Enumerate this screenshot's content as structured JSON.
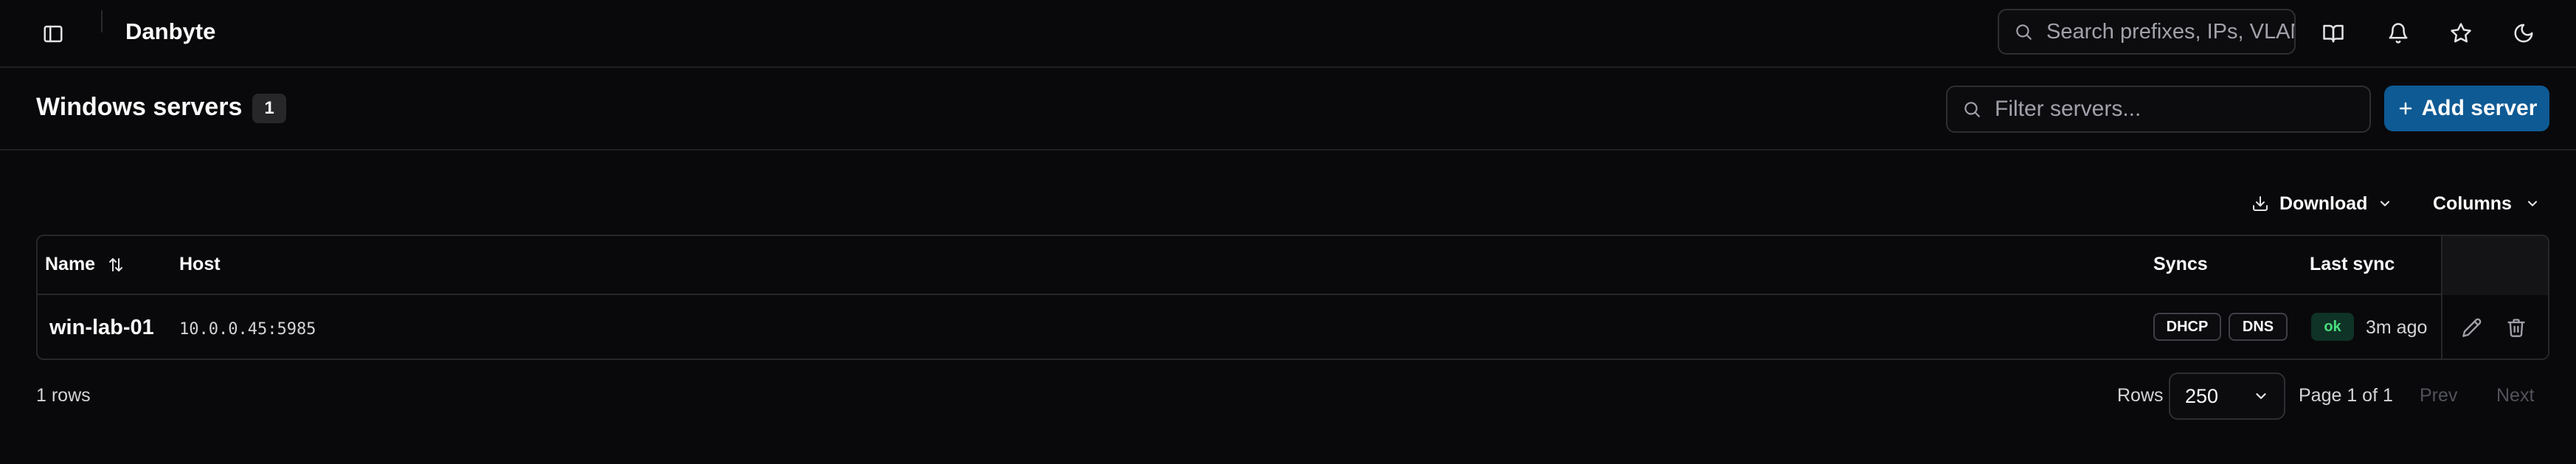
{
  "topbar": {
    "app_title": "Danbyte",
    "search_placeholder": "Search prefixes, IPs, VLANs…",
    "icons": [
      "sidebar-toggle-icon",
      "book-icon",
      "bell-icon",
      "star-icon",
      "moon-icon"
    ]
  },
  "header": {
    "title": "Windows servers",
    "count": "1",
    "filter_placeholder": "Filter servers...",
    "add_label": "Add server"
  },
  "toolbar": {
    "download_label": "Download",
    "columns_label": "Columns"
  },
  "table": {
    "columns": {
      "name": "Name",
      "host": "Host",
      "syncs": "Syncs",
      "last_sync": "Last sync"
    },
    "rows": [
      {
        "name": "win-lab-01",
        "host": "10.0.0.45:5985",
        "syncs": [
          "DHCP",
          "DNS"
        ],
        "status": "ok",
        "last_sync": "3m ago"
      }
    ]
  },
  "footer": {
    "row_count": "1 rows",
    "rows_label": "Rows",
    "rows_per_page": "250",
    "page_info": "Page 1 of 1",
    "prev_label": "Prev",
    "next_label": "Next"
  },
  "colors": {
    "background": "#09090b",
    "primary": "#0e5a94",
    "ok_bg": "#0f3326",
    "ok_text": "#4ade80"
  }
}
